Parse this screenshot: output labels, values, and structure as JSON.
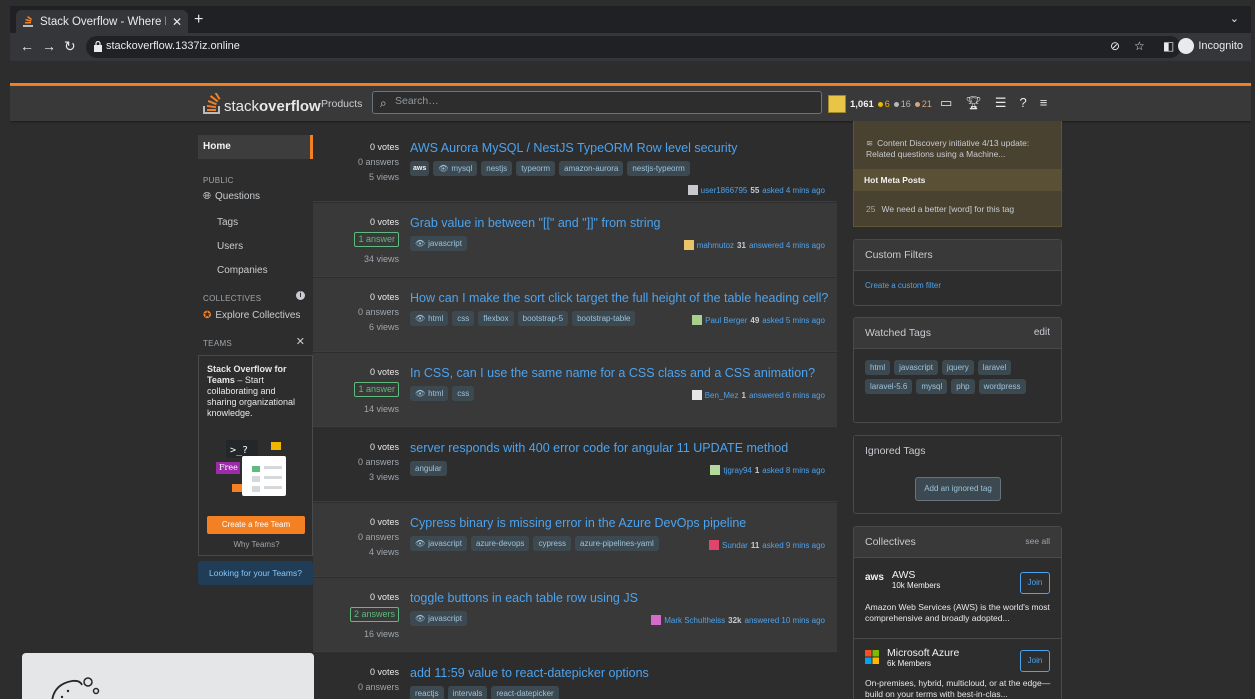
{
  "browser": {
    "tab_title": "Stack Overflow - Where D",
    "url": "stackoverflow.1337iz.online",
    "profile_label": "Incognito"
  },
  "header": {
    "logo_text_plain": "stack",
    "logo_text_bold": "overflow",
    "products_label": "Products",
    "search_placeholder": "Search…",
    "reputation": "1,061",
    "gold": "6",
    "silver": "16",
    "bronze": "21",
    "colors": {
      "accent": "#f48024",
      "gold": "#f1b600",
      "silver": "#b4b8bc",
      "bronze": "#d1a684"
    }
  },
  "leftnav": {
    "home": "Home",
    "public": "PUBLIC",
    "questions": "Questions",
    "tags": "Tags",
    "users": "Users",
    "companies": "Companies",
    "collectives": "COLLECTIVES",
    "explore": "Explore Collectives",
    "teams": "TEAMS",
    "teams_title": "Stack Overflow for Teams",
    "teams_text": " – Start collaborating and sharing organizational knowledge.",
    "free_label": "Free",
    "teams_btn": "Create a free Team",
    "why_teams": "Why Teams?",
    "looking": "Looking for your Teams?"
  },
  "questions": [
    {
      "votes": "0 votes",
      "answers": "0 answers",
      "views": "5 views",
      "title": "AWS Aurora MySQL / NestJS TypeORM Row level security",
      "tags": [
        "aws",
        "mysql",
        "nestjs",
        "typeorm",
        "amazon-aurora",
        "nestjs-typeorm"
      ],
      "user": "user1866795",
      "rep": "55",
      "time": "asked 4 mins ago"
    },
    {
      "votes": "0 votes",
      "answers": "1 answer",
      "views": "34 views",
      "title": "Grab value in between \"[[\" and \"]]\" from string",
      "tags": [
        "javascript"
      ],
      "user": "mahmutoz",
      "rep": "31",
      "time": "answered 4 mins ago"
    },
    {
      "votes": "0 votes",
      "answers": "0 answers",
      "views": "6 views",
      "title": "How can I make the sort click target the full height of the table heading cell?",
      "tags": [
        "html",
        "css",
        "flexbox",
        "bootstrap-5",
        "bootstrap-table"
      ],
      "user": "Paul Berger",
      "rep": "49",
      "time": "asked 5 mins ago"
    },
    {
      "votes": "0 votes",
      "answers": "1 answer",
      "views": "14 views",
      "title": "In CSS, can I use the same name for a CSS class and a CSS animation?",
      "tags": [
        "html",
        "css"
      ],
      "user": "Ben_Mez",
      "rep": "1",
      "time": "answered 6 mins ago"
    },
    {
      "votes": "0 votes",
      "answers": "0 answers",
      "views": "3 views",
      "title": "server responds with 400 error code for angular 11 UPDATE method",
      "tags": [
        "angular"
      ],
      "user": "tjgray94",
      "rep": "1",
      "time": "asked 8 mins ago"
    },
    {
      "votes": "0 votes",
      "answers": "0 answers",
      "views": "4 views",
      "title": "Cypress binary is missing error in the Azure DevOps pipeline",
      "tags": [
        "javascript",
        "azure-devops",
        "cypress",
        "azure-pipelines-yaml"
      ],
      "user": "Sundar",
      "rep": "11",
      "time": "asked 9 mins ago"
    },
    {
      "votes": "0 votes",
      "answers": "2 answers",
      "views": "16 views",
      "title": "toggle buttons in each table row using JS",
      "tags": [
        "javascript"
      ],
      "user": "Mark Schultheiss",
      "rep": "32k",
      "time": "answered 10 mins ago"
    },
    {
      "votes": "0 votes",
      "answers": "0 answers",
      "views": "",
      "title": "add 11:59 value to react-datepicker options",
      "tags": [
        "reactjs",
        "intervals",
        "react-datepicker"
      ],
      "user": "",
      "rep": "",
      "time": ""
    }
  ],
  "sidebar": {
    "meta_row1": "Content Discovery initiative 4/13 update: Related questions using a Machine...",
    "hot_meta": "Hot Meta Posts",
    "meta_count": "25",
    "meta_row2": "We need a better [word] for this tag",
    "custom_filters": "Custom Filters",
    "create_filter": "Create a custom filter",
    "watched_tags": "Watched Tags",
    "edit": "edit",
    "watched": [
      "html",
      "javascript",
      "jquery",
      "laravel",
      "laravel-5.6",
      "mysql",
      "php",
      "wordpress"
    ],
    "ignored_tags": "Ignored Tags",
    "add_ignored": "Add an ignored tag",
    "collectives": "Collectives",
    "see_all": "see all",
    "aws_name": "AWS",
    "aws_members": "10k Members",
    "aws_desc": "Amazon Web Services (AWS) is the world's most comprehensive and broadly adopted...",
    "azure_name": "Microsoft Azure",
    "azure_members": "6k Members",
    "azure_desc": "On-premises, hybrid, multicloud, or at the edge—build on your terms with best-in-clas...",
    "join": "Join"
  }
}
